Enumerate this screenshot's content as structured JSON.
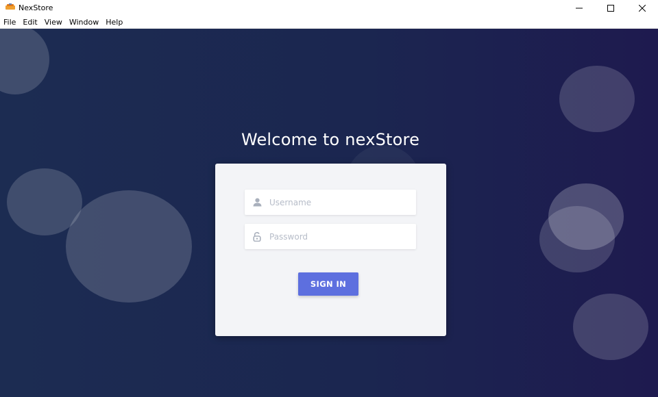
{
  "window": {
    "title": "NexStore",
    "controls": {
      "minimize_icon": "minimize-icon",
      "maximize_icon": "maximize-icon",
      "close_icon": "close-icon"
    }
  },
  "menu": [
    "File",
    "Edit",
    "View",
    "Window",
    "Help"
  ],
  "login": {
    "heading": "Welcome to nexStore",
    "username": {
      "placeholder": "Username",
      "value": "",
      "icon": "user-icon"
    },
    "password": {
      "placeholder": "Password",
      "value": "",
      "icon": "lock-icon"
    },
    "submit_label": "SIGN IN"
  },
  "colors": {
    "background": "#1b2650",
    "card": "#f3f4f7",
    "accent": "#5d6fdf",
    "placeholder": "#b6bcc8"
  }
}
